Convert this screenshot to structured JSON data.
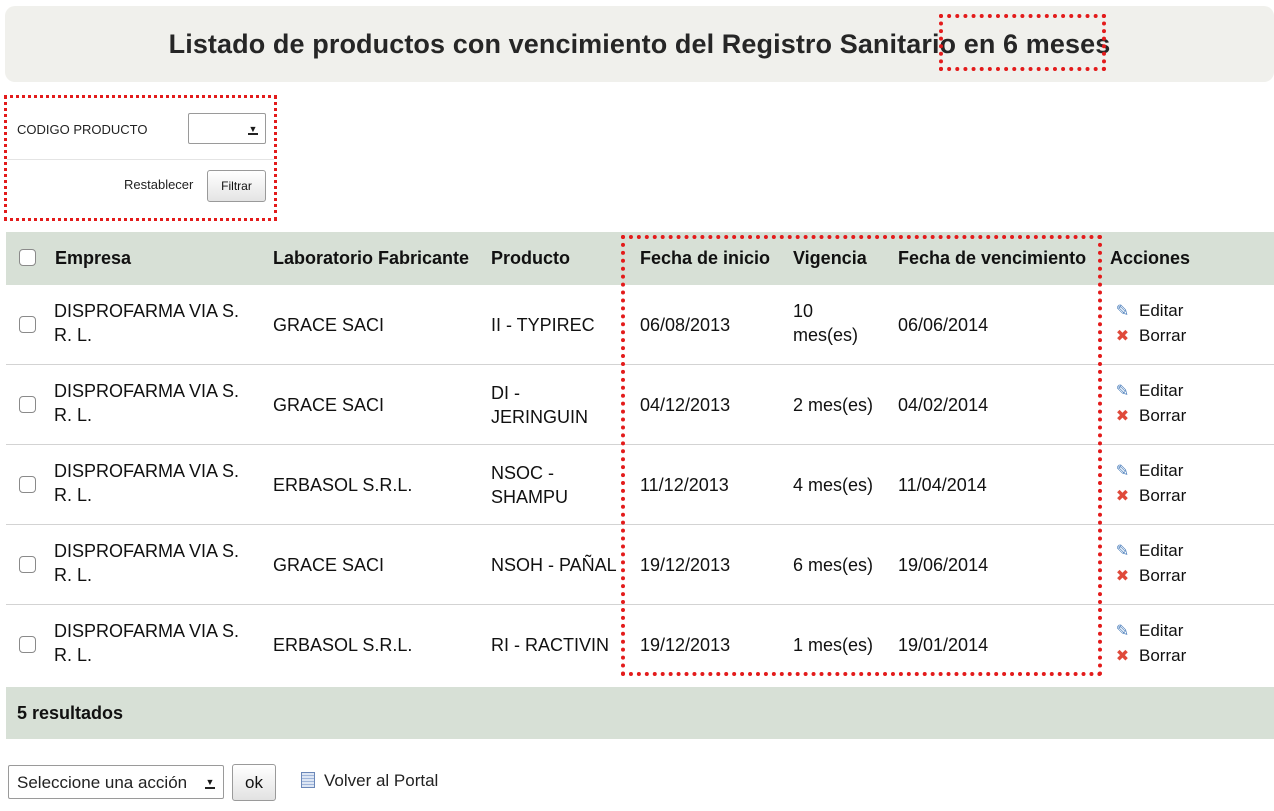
{
  "title": {
    "main": "Listado de productos con vencimiento del Registro Sanitario ",
    "highlight": "en 6 meses"
  },
  "filter": {
    "code_label": "CODIGO PRODUCTO",
    "code_value": "",
    "reset_label": "Restablecer",
    "filter_button": "Filtrar"
  },
  "table": {
    "headers": {
      "empresa": "Empresa",
      "laboratorio": "Laboratorio Fabricante",
      "producto": "Producto",
      "fecha_inicio": "Fecha de inicio",
      "vigencia": "Vigencia",
      "fecha_vencimiento": "Fecha de vencimiento",
      "acciones": "Acciones"
    },
    "rows": [
      {
        "empresa_1": "DISPROFARMA VIA S.",
        "empresa_2": "R. L.",
        "laboratorio": "GRACE SACI",
        "producto_1": "II - TYPIREC",
        "producto_2": "",
        "fecha_inicio": "06/08/2013",
        "vigencia_1": "10",
        "vigencia_2": "mes(es)",
        "fecha_vencimiento": "06/06/2014",
        "editar": "Editar",
        "borrar": "Borrar"
      },
      {
        "empresa_1": "DISPROFARMA VIA S.",
        "empresa_2": "R. L.",
        "laboratorio": "GRACE SACI",
        "producto_1": "DI -",
        "producto_2": "JERINGUIN",
        "fecha_inicio": "04/12/2013",
        "vigencia_1": "2 mes(es)",
        "vigencia_2": "",
        "fecha_vencimiento": "04/02/2014",
        "editar": "Editar",
        "borrar": "Borrar"
      },
      {
        "empresa_1": "DISPROFARMA VIA S.",
        "empresa_2": "R. L.",
        "laboratorio": "ERBASOL S.R.L.",
        "producto_1": "NSOC -",
        "producto_2": "SHAMPU",
        "fecha_inicio": "11/12/2013",
        "vigencia_1": "4 mes(es)",
        "vigencia_2": "",
        "fecha_vencimiento": "11/04/2014",
        "editar": "Editar",
        "borrar": "Borrar"
      },
      {
        "empresa_1": "DISPROFARMA VIA S.",
        "empresa_2": "R. L.",
        "laboratorio": "GRACE SACI",
        "producto_1": "NSOH - PAÑAL",
        "producto_2": "",
        "fecha_inicio": "19/12/2013",
        "vigencia_1": "6 mes(es)",
        "vigencia_2": "",
        "fecha_vencimiento": "19/06/2014",
        "editar": "Editar",
        "borrar": "Borrar"
      },
      {
        "empresa_1": "DISPROFARMA VIA S.",
        "empresa_2": "R. L.",
        "laboratorio": "ERBASOL S.R.L.",
        "producto_1": "RI - RACTIVIN",
        "producto_2": "",
        "fecha_inicio": "19/12/2013",
        "vigencia_1": "1 mes(es)",
        "vigencia_2": "",
        "fecha_vencimiento": "19/01/2014",
        "editar": "Editar",
        "borrar": "Borrar"
      }
    ],
    "results": "5 resultados"
  },
  "bottom": {
    "action_select": "Seleccione una acción",
    "ok_button": "ok",
    "portal_link": "Volver al Portal"
  },
  "colors": {
    "accent_red": "#e31b1b",
    "header_bg": "#d7e0d6",
    "title_bg": "#f0f0ec"
  }
}
